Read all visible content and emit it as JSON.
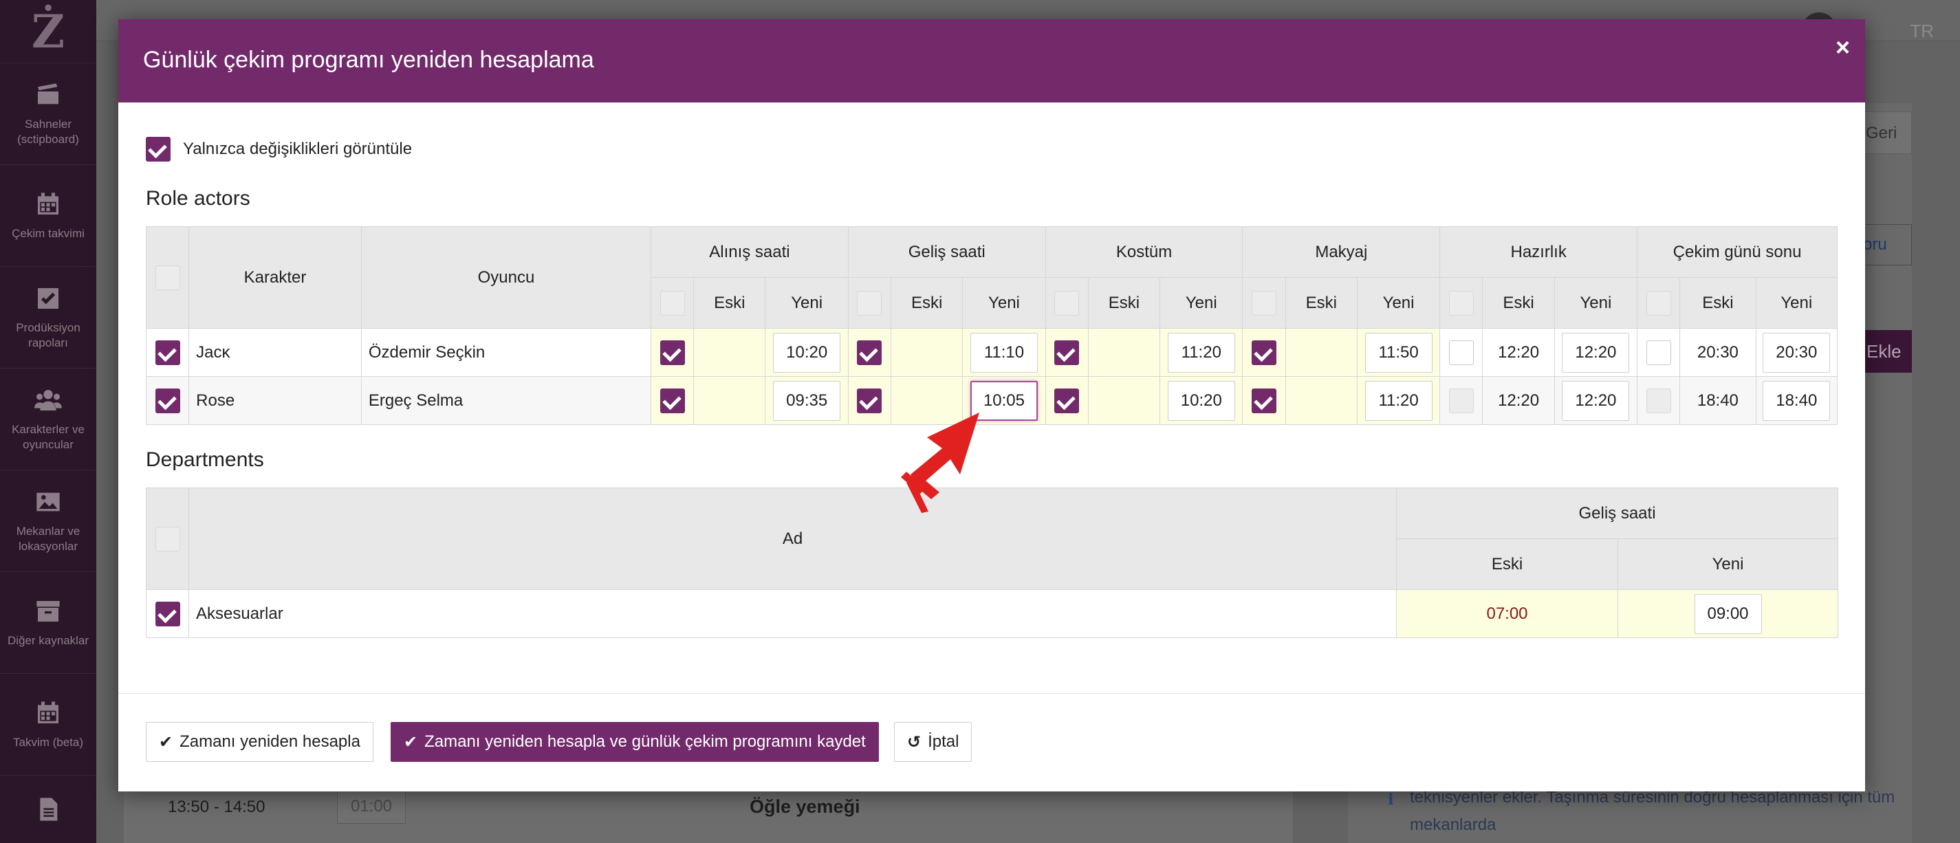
{
  "sidebar": {
    "logo": "Ż",
    "items": [
      {
        "label": "Sahneler (sctipboard)",
        "icon": "clapperboard-icon"
      },
      {
        "label": "Çekim takvimi",
        "icon": "calendar-icon"
      },
      {
        "label": "Prodüksiyon rapoları",
        "icon": "checkbox-icon"
      },
      {
        "label": "Karakterler ve oyuncular",
        "icon": "users-icon"
      },
      {
        "label": "Mekanlar ve lokasyonlar",
        "icon": "image-icon"
      },
      {
        "label": "Diğer kaynaklar",
        "icon": "archive-icon"
      },
      {
        "label": "Takvim (beta)",
        "icon": "calendar-icon"
      },
      {
        "label": "",
        "icon": "document-icon"
      }
    ]
  },
  "background": {
    "lang": "TR",
    "back_button": "Geri",
    "other_button": "oru",
    "add_button": "Ekle",
    "lunch_time": "13:50 - 14:50",
    "lunch_duration": "01:00",
    "lunch_label": "Öğle yemeği",
    "info_text": "olarak hesapla kullan ve trafik sıkışıklığını dikkate alarak teknisyenler ekler. Taşınma süresinin doğru hesaplanması için tüm mekanlarda"
  },
  "modal": {
    "title": "Günlük çekim programı yeniden hesaplama",
    "close": "×",
    "only_changes_label": "Yalnızca değişiklikleri görüntüle",
    "role_actors_title": "Role actors",
    "departments_title": "Departments",
    "roles_table": {
      "col_character": "Karakter",
      "col_actor": "Oyuncu",
      "groups": [
        "Alınış saati",
        "Geliş saati",
        "Kostüm",
        "Makyaj",
        "Hazırlık",
        "Çekim günü sonu"
      ],
      "sub_old": "Eski",
      "sub_new": "Yeni",
      "rows": [
        {
          "character": "Jacĸ",
          "actor": "Özdemir Seçkin",
          "cells": [
            {
              "checked": true,
              "old": "",
              "new": "10:20"
            },
            {
              "checked": true,
              "old": "",
              "new": "11:10"
            },
            {
              "checked": true,
              "old": "",
              "new": "11:20"
            },
            {
              "checked": true,
              "old": "",
              "new": "11:50"
            },
            {
              "checked": false,
              "old": "12:20",
              "new": "12:20"
            },
            {
              "checked": false,
              "old": "20:30",
              "new": "20:30"
            }
          ]
        },
        {
          "character": "Rose",
          "actor": "Ergeç Selma",
          "cells": [
            {
              "checked": true,
              "old": "",
              "new": "09:35"
            },
            {
              "checked": true,
              "old": "",
              "new": "10:05"
            },
            {
              "checked": true,
              "old": "",
              "new": "10:20"
            },
            {
              "checked": true,
              "old": "",
              "new": "11:20"
            },
            {
              "checked": false,
              "old": "12:20",
              "new": "12:20"
            },
            {
              "checked": false,
              "old": "18:40",
              "new": "18:40"
            }
          ]
        }
      ]
    },
    "departments_table": {
      "col_name": "Ad",
      "group": "Geliş saati",
      "sub_old": "Eski",
      "sub_new": "Yeni",
      "rows": [
        {
          "name": "Aksesuarlar",
          "old": "07:00",
          "new": "09:00"
        }
      ]
    },
    "buttons": {
      "recalc": "Zamanı yeniden hesapla",
      "recalc_save": "Zamanı yeniden hesapla ve günlük çekim programını kaydet",
      "cancel": "İptal"
    }
  },
  "colors": {
    "brand": "#722a6b",
    "highlight_cell": "#fdfde0",
    "arrow": "#e0211f"
  }
}
